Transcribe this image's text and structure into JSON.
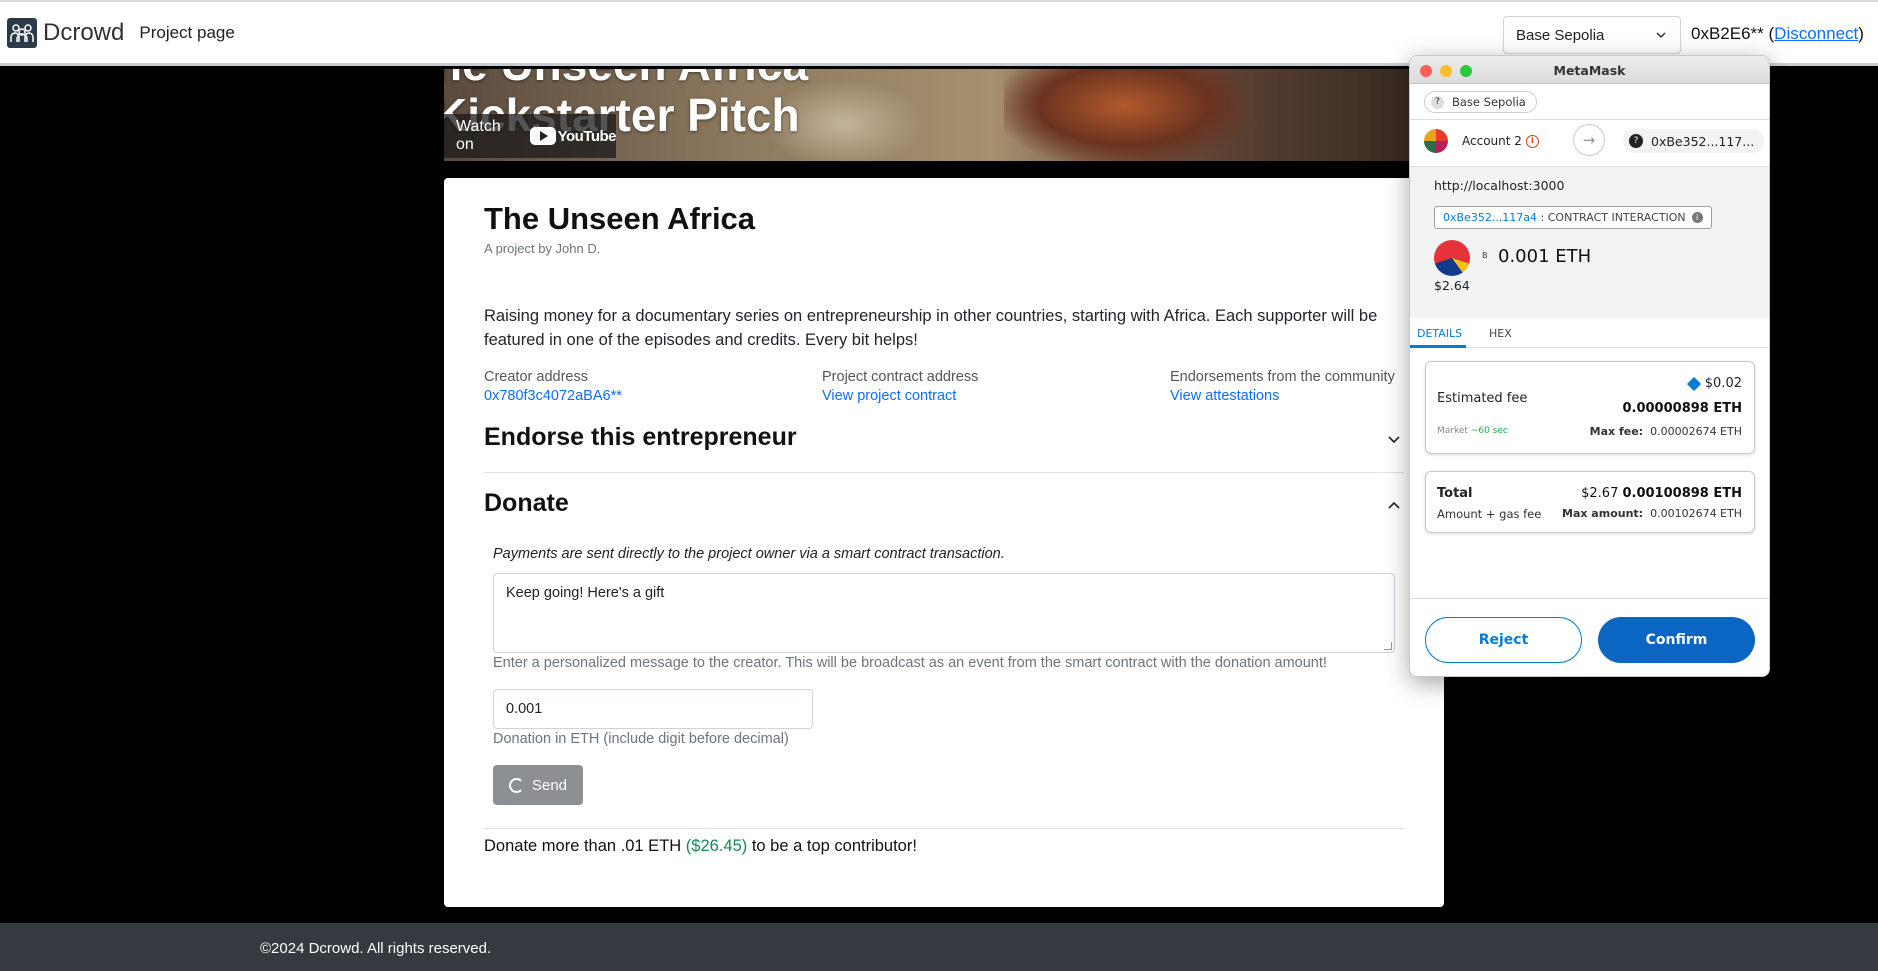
{
  "navbar": {
    "brand": "Dcrowd",
    "page_link": "Project page",
    "network": "Base Sepolia",
    "account": "0xB2E6**",
    "disconnect": "Disconnect"
  },
  "video": {
    "title_line1": "he Unseen Africa",
    "title_line2": "Kickstarter Pitch",
    "watch_on": "Watch on",
    "youtube": "YouTube"
  },
  "project": {
    "title": "The Unseen Africa",
    "byline": "A project by John D.",
    "description": "Raising money for a documentary series on entrepreneurship in other countries, starting with Africa. Each supporter will be featured in one of the episodes and credits. Every bit helps!",
    "creator_label": "Creator address",
    "creator_value": "0x780f3c4072aBA6**",
    "contract_label": "Project contract address",
    "contract_value": "View project contract",
    "endorse_label": "Endorsements from the community",
    "endorse_value": "View attestations"
  },
  "endorse_section": {
    "heading": "Endorse this entrepreneur"
  },
  "donate_section": {
    "heading": "Donate",
    "note": "Payments are sent directly to the project owner via a smart contract transaction.",
    "message_value": "Keep going! Here's a gift",
    "message_help": "Enter a personalized message to the creator. This will be broadcast as an event from the smart contract with the donation amount!",
    "amount_value": "0.001",
    "amount_help": "Donation in ETH (include digit before decimal)",
    "send_label": "Send",
    "top_pre": "Donate more than .01 ETH ",
    "top_usd": "($26.45)",
    "top_post": " to be a top contributor!"
  },
  "footer": {
    "text": "©2024 Dcrowd. All rights reserved."
  },
  "metamask": {
    "window_title": "MetaMask",
    "network": "Base Sepolia",
    "account": "Account 2",
    "to_address": "0xBe352...117...",
    "origin": "http://localhost:3000",
    "contract_addr": "0xBe352...117a4",
    "contract_label": ": CONTRACT INTERACTION",
    "asset_symbol": "B",
    "amount": "0.001 ETH",
    "amount_usd": "$2.64",
    "tab_details": "DETAILS",
    "tab_hex": "HEX",
    "fee_label": "Estimated fee",
    "fee_usd": "$0.02",
    "fee_eth": "0.00000898 ETH",
    "market": "Market",
    "market_time": "~60 sec",
    "max_fee_label": "Max fee:",
    "max_fee_value": "0.00002674 ETH",
    "total_label": "Total",
    "total_usd": "$2.67",
    "total_eth": "0.00100898 ETH",
    "total_sub": "Amount + gas fee",
    "max_amount_label": "Max amount:",
    "max_amount_value": "0.00102674 ETH",
    "reject": "Reject",
    "confirm": "Confirm"
  },
  "colors": {
    "primary": "#0d6efd",
    "metamask_blue": "#037dd6",
    "success": "#198754",
    "footer_bg": "#343a40"
  }
}
